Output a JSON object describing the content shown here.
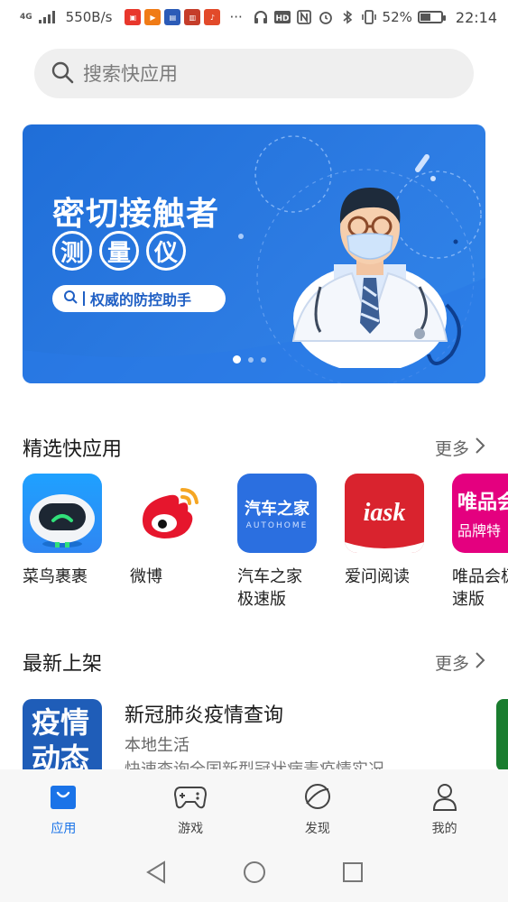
{
  "status_bar": {
    "network_tag": "4G",
    "net_speed": "550B/s",
    "more_notifications": "···",
    "battery_percent": "52%",
    "battery_level": 0.52,
    "time": "22:14",
    "icons": [
      "signal-icon",
      "headphones-icon",
      "hd-icon",
      "nfc-icon",
      "alarm-icon",
      "bluetooth-icon",
      "vibrate-icon",
      "battery-icon"
    ]
  },
  "search": {
    "placeholder": "搜索快应用"
  },
  "banner": {
    "title": "密切接触者",
    "circle_chars": [
      "测",
      "量",
      "仪"
    ],
    "pill_text": "权威的防控助手",
    "slide_count": 3,
    "active_slide": 1
  },
  "featured": {
    "title": "精选快应用",
    "more_label": "更多",
    "apps": [
      {
        "name": "菜鸟裹裹",
        "icon": "cainiao-robot-icon"
      },
      {
        "name": "微博",
        "icon": "weibo-icon"
      },
      {
        "name": "汽车之家极速版",
        "icon": "autohome-icon",
        "icon_text": "汽车之家",
        "icon_subtext": "AUTOHOME"
      },
      {
        "name": "爱问阅读",
        "icon": "iask-icon",
        "icon_text": "iask"
      },
      {
        "name": "唯品会极速版",
        "icon": "vip-icon",
        "icon_text": "唯品会",
        "icon_subtext": "品牌特"
      }
    ]
  },
  "latest": {
    "title": "最新上架",
    "more_label": "更多",
    "items": [
      {
        "icon_text_line1": "疫情",
        "icon_text_line2": "动态",
        "name": "新冠肺炎疫情查询",
        "category": "本地生活",
        "description": "快速查询全国新型冠状病毒疫情实况"
      }
    ]
  },
  "bottom_nav": {
    "items": [
      {
        "label": "应用",
        "icon": "shopping-bag-icon",
        "active": true
      },
      {
        "label": "游戏",
        "icon": "gamepad-icon",
        "active": false
      },
      {
        "label": "发现",
        "icon": "planet-icon",
        "active": false
      },
      {
        "label": "我的",
        "icon": "person-icon",
        "active": false
      }
    ]
  },
  "colors": {
    "accent": "#1a73e8",
    "banner_blue": "#2a78e0",
    "weibo_red": "#e6162d",
    "autohome_blue": "#2b6fe0",
    "iask_red": "#d9232e",
    "vip_pink": "#e4007f"
  }
}
